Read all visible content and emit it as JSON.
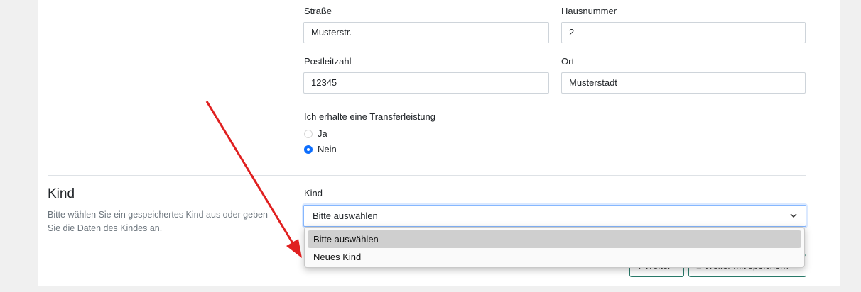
{
  "address": {
    "street_label": "Straße",
    "street_value": "Musterstr.",
    "number_label": "Hausnummer",
    "number_value": "2",
    "zip_label": "Postleitzahl",
    "zip_value": "12345",
    "city_label": "Ort",
    "city_value": "Musterstadt"
  },
  "transfer": {
    "question": "Ich erhalte eine Transferleistung",
    "options": [
      {
        "label": "Ja",
        "checked": false
      },
      {
        "label": "Nein",
        "checked": true
      }
    ]
  },
  "child_section": {
    "title": "Kind",
    "description": "Bitte wählen Sie ein gespeichertes Kind aus oder geben Sie die Daten des Kindes an.",
    "select_label": "Kind",
    "select_value": "Bitte auswählen",
    "options": [
      "Bitte auswählen",
      "Neues Kind"
    ]
  },
  "actions": {
    "next_label": "Weiter",
    "next_save_label": "Weiter mit speichern"
  },
  "colors": {
    "accent": "#0d6efd",
    "annotation_arrow": "#e02020"
  },
  "icons": {
    "select_chevron": "chevron-down-icon",
    "next": "arrow-down-icon",
    "save": "save-icon"
  }
}
